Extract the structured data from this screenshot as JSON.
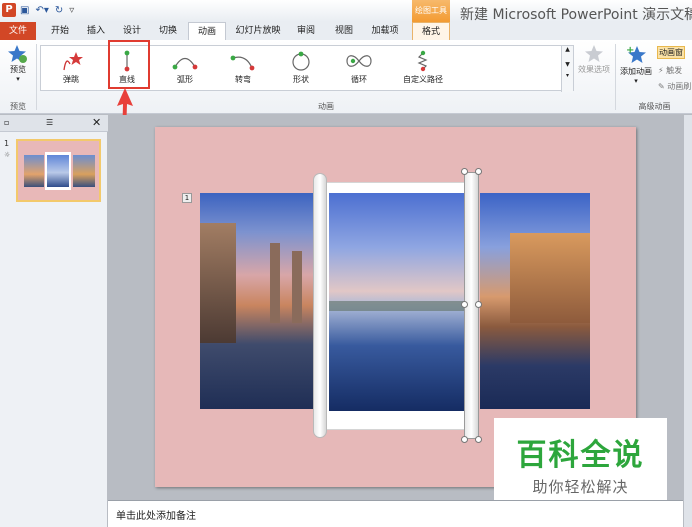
{
  "titlebar": {
    "app_icon_letter": "P",
    "contextual_tab": "绘图工具",
    "window_title": "新建 Microsoft PowerPoint 演示文稿."
  },
  "tabs": [
    "文件",
    "开始",
    "插入",
    "设计",
    "切换",
    "动画",
    "幻灯片放映",
    "审阅",
    "视图",
    "加载项",
    "格式"
  ],
  "ribbon": {
    "preview": {
      "label": "预览",
      "group": "预览"
    },
    "animations": [
      {
        "label": "弹跳",
        "icon": "bounce-star-icon"
      },
      {
        "label": "直线",
        "icon": "line-path-icon"
      },
      {
        "label": "弧形",
        "icon": "arc-path-icon"
      },
      {
        "label": "转弯",
        "icon": "turn-path-icon"
      },
      {
        "label": "形状",
        "icon": "shape-path-icon"
      },
      {
        "label": "循环",
        "icon": "loop-path-icon"
      },
      {
        "label": "自定义路径",
        "icon": "custom-path-icon"
      }
    ],
    "animation_group": "动画",
    "effect_options": "效果选项",
    "add_animation": "添加动画",
    "anim_pane": "动画窗",
    "trigger": "触发",
    "anim_painter": "动画刷",
    "advanced_group": "高级动画"
  },
  "slidepane": {
    "slide_number": "1"
  },
  "slide": {
    "anim_tag": "1"
  },
  "notes_placeholder": "单击此处添加备注",
  "watermark": {
    "title": "百科全说",
    "subtitle": "助你轻松解决"
  },
  "colors": {
    "file_tab": "#d24726",
    "highlight": "#e03b30",
    "slide_bg": "#e6b8b8",
    "watermark_green": "#2da63c"
  }
}
